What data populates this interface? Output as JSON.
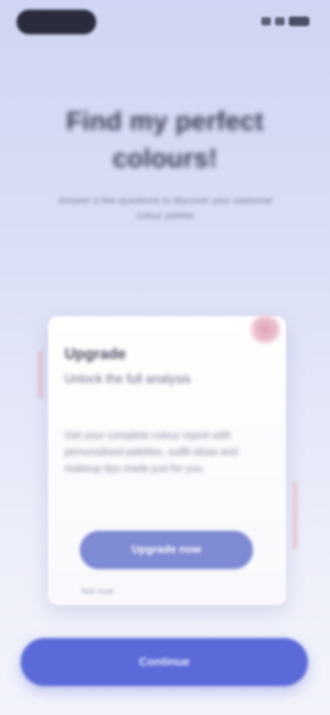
{
  "header": {
    "title": "Find my perfect colours!",
    "subtitle": "Answer a few questions to discover your seasonal colour palette"
  },
  "card": {
    "heading": "Upgrade",
    "subheading": "Unlock the full analysis",
    "body": "Get your complete colour report with personalised palettes, outfit ideas and makeup tips made just for you.",
    "button_label": "Upgrade now",
    "link_label": "Not now"
  },
  "primary_button": {
    "label": "Continue"
  },
  "colors": {
    "accent": "#5b6ad8",
    "card_button": "#7f8ad4",
    "close_badge": "#e0a1b4"
  }
}
